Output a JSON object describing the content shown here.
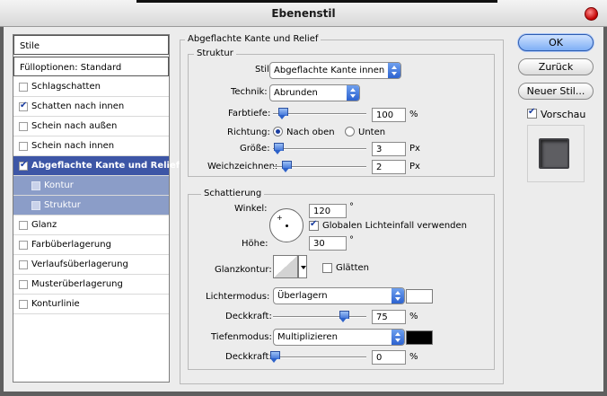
{
  "window": {
    "title": "Ebenenstil"
  },
  "left_panel": {
    "header": "Stile",
    "fill_options": "Fülloptionen: Standard",
    "items": [
      {
        "label": "Schlagschatten",
        "checked": false
      },
      {
        "label": "Schatten nach innen",
        "checked": true
      },
      {
        "label": "Schein nach außen",
        "checked": false
      },
      {
        "label": "Schein nach innen",
        "checked": false
      },
      {
        "label": "Abgeflachte Kante und Relief",
        "checked": true,
        "selected": true
      },
      {
        "label": "Kontur",
        "checked": false,
        "sub": true
      },
      {
        "label": "Struktur",
        "checked": false,
        "sub": true
      },
      {
        "label": "Glanz",
        "checked": false
      },
      {
        "label": "Farbüberlagerung",
        "checked": false
      },
      {
        "label": "Verlaufsüberlagerung",
        "checked": false
      },
      {
        "label": "Musterüberlagerung",
        "checked": false
      },
      {
        "label": "Konturlinie",
        "checked": false
      }
    ]
  },
  "main": {
    "group_title": "Abgeflachte Kante und Relief",
    "structure": {
      "title": "Struktur",
      "style_label": "Stil:",
      "style_value": "Abgeflachte Kante innen",
      "technique_label": "Technik:",
      "technique_value": "Abrunden",
      "depth_label": "Farbtiefe:",
      "depth_value": "100",
      "depth_unit": "%",
      "depth_slider": 0.08,
      "direction_label": "Richtung:",
      "direction_up": "Nach oben",
      "direction_down": "Unten",
      "direction_selected": "up",
      "size_label": "Größe:",
      "size_value": "3",
      "size_unit": "Px",
      "size_slider": 0.02,
      "soften_label": "Weichzeichnen:",
      "soften_value": "2",
      "soften_unit": "Px",
      "soften_slider": 0.1
    },
    "shading": {
      "title": "Schattierung",
      "angle_label": "Winkel:",
      "angle_value": "120",
      "angle_unit": "°",
      "global_light": "Globalen Lichteinfall verwenden",
      "global_light_checked": true,
      "altitude_label": "Höhe:",
      "altitude_value": "30",
      "altitude_unit": "°",
      "gloss_label": "Glanzkontur:",
      "antialias_label": "Glätten",
      "antialias_checked": false,
      "highlight_mode_label": "Lichtermodus:",
      "highlight_mode_value": "Überlagern",
      "highlight_color": "#ffffff",
      "highlight_opacity_label": "Deckkraft:",
      "highlight_opacity_value": "75",
      "highlight_opacity_unit": "%",
      "highlight_opacity_slider": 0.75,
      "shadow_mode_label": "Tiefenmodus:",
      "shadow_mode_value": "Multiplizieren",
      "shadow_color": "#000000",
      "shadow_opacity_label": "Deckkraft:",
      "shadow_opacity_value": "0",
      "shadow_opacity_unit": "%",
      "shadow_opacity_slider": 0.0
    }
  },
  "buttons": {
    "ok": "OK",
    "back": "Zurück",
    "new_style": "Neuer Stil...",
    "preview_label": "Vorschau",
    "preview_checked": true
  }
}
